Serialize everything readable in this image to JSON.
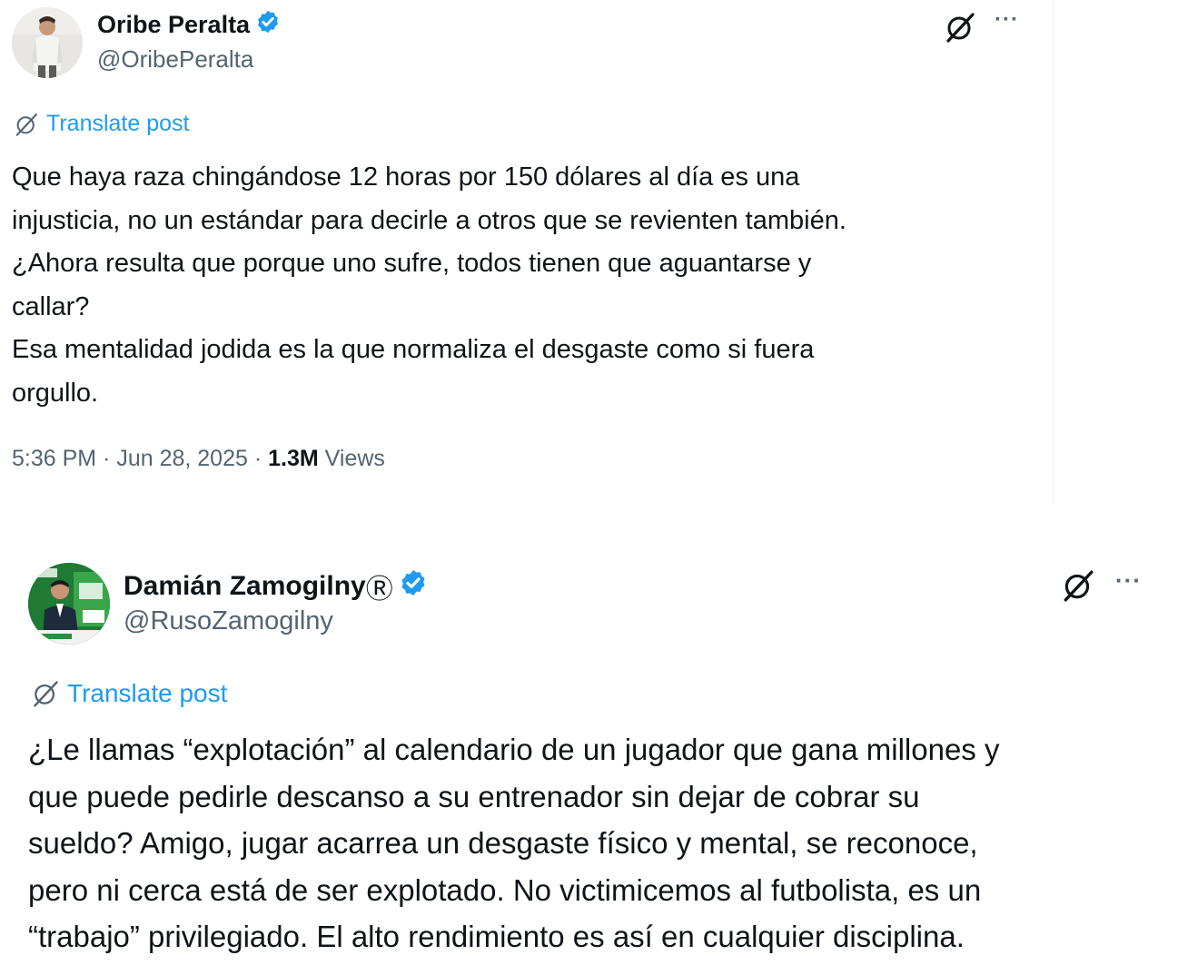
{
  "tweets": [
    {
      "author_name": "Oribe Peralta",
      "handle": "@OribePeralta",
      "translate_label": "Translate post",
      "lines": [
        "Que haya raza chingándose 12 horas por 150 dólares al día es una",
        "injusticia, no un estándar para decirle a otros que se revienten también.",
        "¿Ahora resulta que porque uno sufre, todos tienen que aguantarse y",
        "callar?",
        "Esa mentalidad jodida es la que normaliza el desgaste como si fuera",
        "orgullo."
      ],
      "time": "5:36 PM",
      "date": "Jun 28, 2025",
      "separator": " · ",
      "views_count": "1.3M",
      "views_label": "Views"
    },
    {
      "author_name": "Damián Zamogilny",
      "name_suffix": "Ⓡ",
      "handle": "@RusoZamogilny",
      "translate_label": "Translate post",
      "lines": [
        "¿Le llamas “explotación” al calendario de un jugador que gana millones y",
        "que puede pedirle descanso a su entrenador sin dejar de cobrar su",
        "sueldo? Amigo, jugar acarrea un desgaste físico y mental, se reconoce,",
        "pero ni cerca está de ser explotado. No victimicemos al futbolista, es un",
        "“trabajo” privilegiado. El alto rendimiento es así en cualquier disciplina."
      ]
    }
  ],
  "icons": {
    "verified": "verified-badge-icon",
    "grok": "grok-icon",
    "more": "more-icon",
    "more_glyph": "···"
  },
  "colors": {
    "accent": "#1d9bf0",
    "secondary_text": "#536471",
    "primary_text": "#0f1419"
  }
}
